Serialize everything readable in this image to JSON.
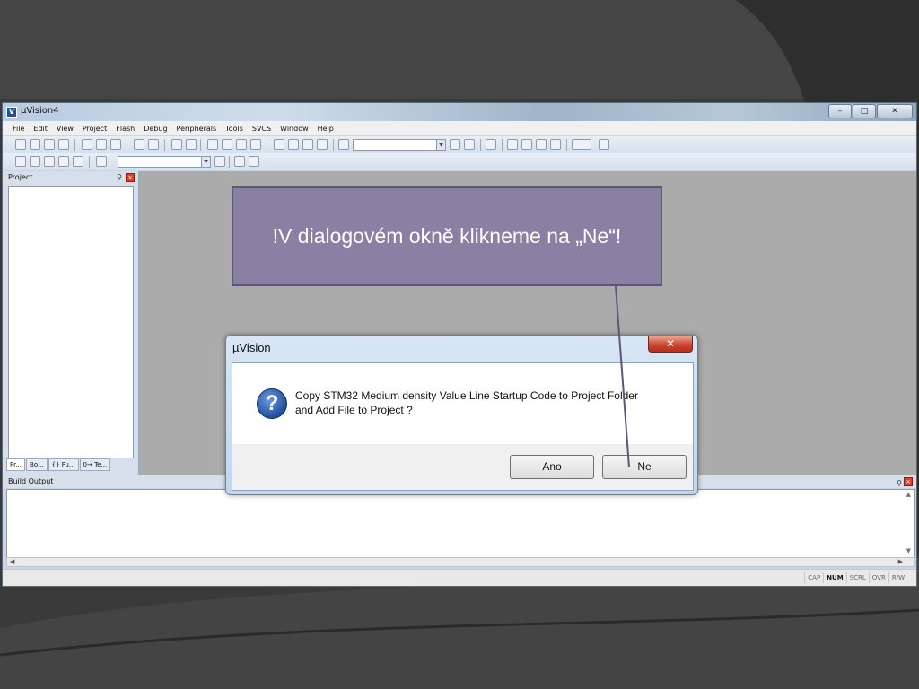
{
  "window": {
    "title": "µVision4",
    "app_icon_letter": "V",
    "controls": [
      "minimize",
      "maximize",
      "close"
    ]
  },
  "menu": [
    "File",
    "Edit",
    "View",
    "Project",
    "Flash",
    "Debug",
    "Peripherals",
    "Tools",
    "SVCS",
    "Window",
    "Help"
  ],
  "project_pane": {
    "title": "Project",
    "tabs": [
      "Pr...",
      "Bo...",
      "{} Fu...",
      "0→ Te..."
    ]
  },
  "build_output": {
    "title": "Build Output"
  },
  "statusbar": {
    "indicators": [
      {
        "label": "CAP",
        "active": false
      },
      {
        "label": "NUM",
        "active": true
      },
      {
        "label": "SCRL",
        "active": false
      },
      {
        "label": "OVR",
        "active": false
      },
      {
        "label": "R/W",
        "active": false
      }
    ]
  },
  "callout": {
    "text": "!V dialogovém okně klikneme na „Ne“!",
    "color": "#8a80a4"
  },
  "dialog": {
    "title": "µVision",
    "message_line1": "Copy STM32 Medium density Value Line Startup Code to Project Folder",
    "message_line2": "and Add File to Project ?",
    "yes_label": "Ano",
    "no_label": "Ne",
    "icon": "question-icon"
  }
}
